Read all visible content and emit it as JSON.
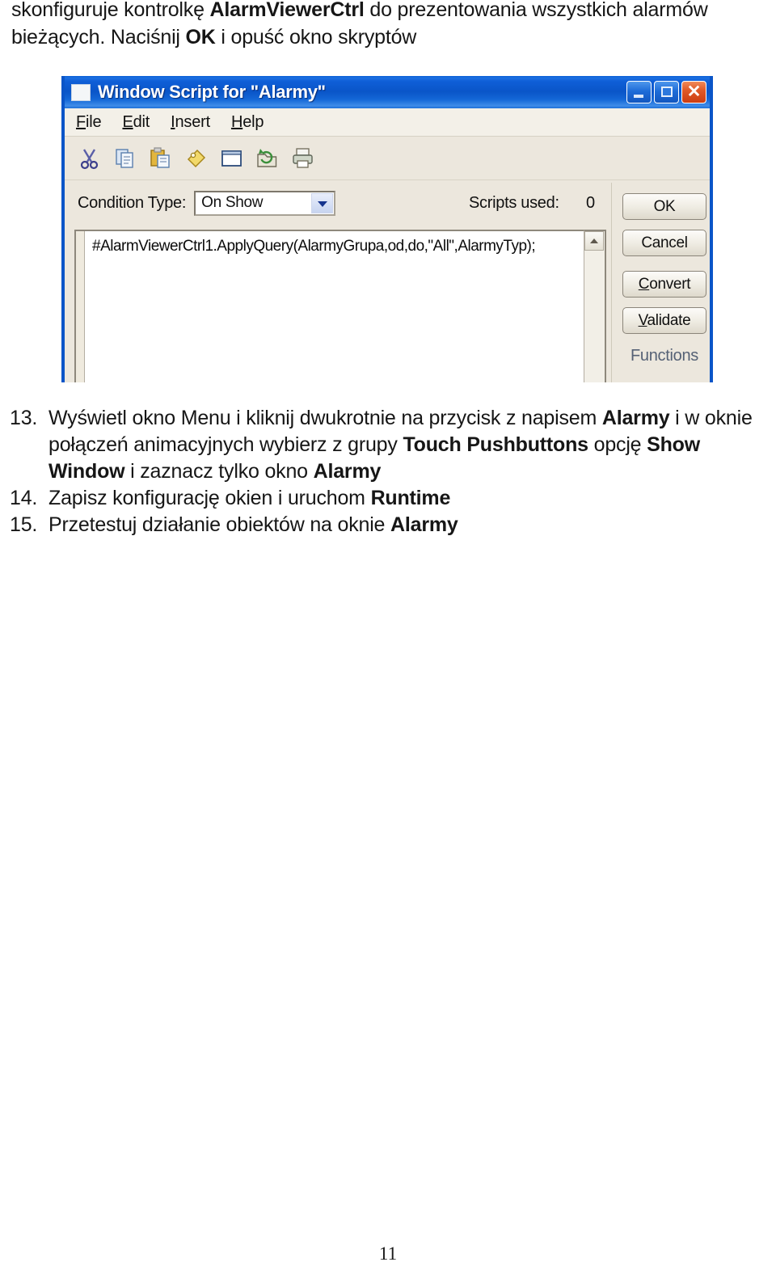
{
  "document": {
    "intro": {
      "line1_before": "skonfiguruje kontrolkę ",
      "line1_bold": "AlarmViewerCtrl",
      "line1_after": " do prezentowania wszystkich alarmów",
      "line2_before": "bieżących. Naciśnij ",
      "line2_bold": "OK",
      "line2_after": " i opuść okno skryptów"
    },
    "list": [
      {
        "number": "13.",
        "segments": [
          {
            "text": "Wyświetl okno Menu i kliknij dwukrotnie na przycisk z napisem ",
            "bold": false
          },
          {
            "text": "Alarmy",
            "bold": true
          },
          {
            "text": " i w oknie połączeń animacyjnych wybierz z grupy ",
            "bold": false
          },
          {
            "text": "Touch Pushbuttons",
            "bold": true
          },
          {
            "text": " opcję ",
            "bold": false
          },
          {
            "text": "Show Window",
            "bold": true
          },
          {
            "text": "  i zaznacz tylko okno ",
            "bold": false
          },
          {
            "text": "Alarmy",
            "bold": true
          }
        ]
      },
      {
        "number": "14.",
        "segments": [
          {
            "text": "Zapisz konfigurację okien i uruchom ",
            "bold": false
          },
          {
            "text": "Runtime",
            "bold": true
          }
        ]
      },
      {
        "number": "15.",
        "segments": [
          {
            "text": "Przetestuj działanie obiektów na oknie ",
            "bold": false
          },
          {
            "text": "Alarmy",
            "bold": true
          }
        ]
      }
    ],
    "page_number": "11"
  },
  "figure": {
    "window": {
      "title": "Window Script for \"Alarmy\"",
      "icon": "window-icon",
      "controls": {
        "minimize": "minimize-icon",
        "maximize": "maximize-icon",
        "close": "✕"
      }
    },
    "menu": [
      {
        "accel": "F",
        "rest": "ile"
      },
      {
        "accel": "E",
        "rest": "dit"
      },
      {
        "accel": "I",
        "rest": "nsert"
      },
      {
        "accel": "H",
        "rest": "elp"
      }
    ],
    "toolbar": [
      "cut-icon",
      "copy-icon",
      "paste-icon",
      "tag-icon",
      "window-icon",
      "folder-refresh-icon",
      "print-icon"
    ],
    "condition": {
      "label": "Condition Type:",
      "value": "On Show",
      "options": [
        "On Show"
      ]
    },
    "scripts_used": {
      "label": "Scripts used:",
      "count": "0"
    },
    "editor": {
      "script": "#AlarmViewerCtrl1.ApplyQuery(AlarmyGrupa,od,do,\"All\",AlarmyTyp);"
    },
    "buttons": [
      {
        "label": "OK",
        "accel": ""
      },
      {
        "label": "Cancel",
        "accel": ""
      },
      {
        "label": "Convert",
        "accel": "C"
      },
      {
        "label": "Validate",
        "accel": "V"
      }
    ],
    "functions_label": "Functions",
    "colors": {
      "titlebar_blue": "#0a55c8",
      "dialog_beige": "#ece7dd",
      "close_red": "#cc3d12",
      "editor_white": "#ffffff"
    }
  }
}
